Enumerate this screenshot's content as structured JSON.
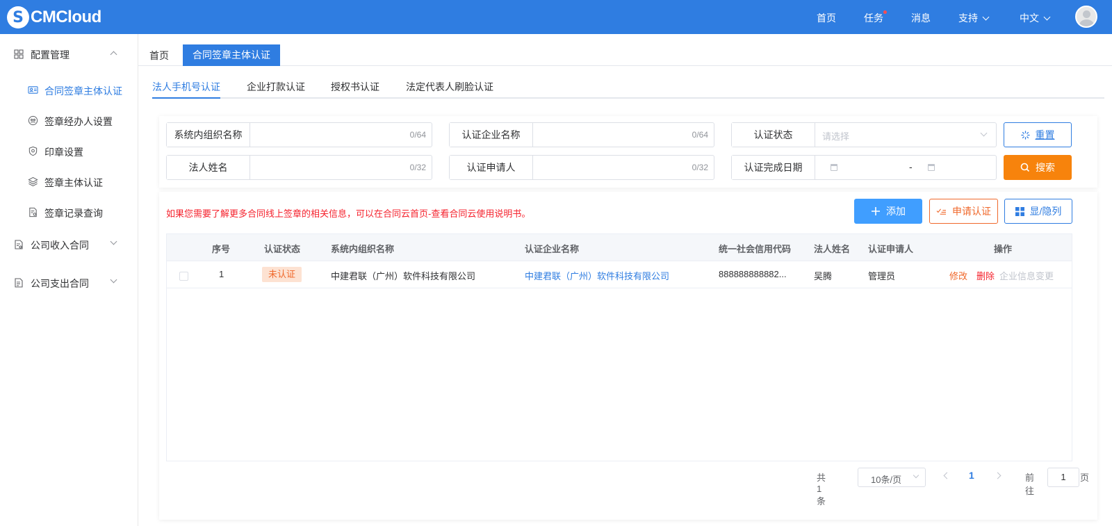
{
  "header": {
    "logo_letter": "S",
    "logo_text": "CMCloud",
    "nav": {
      "home": "首页",
      "tasks": "任务",
      "messages": "消息",
      "support": "支持",
      "language": "中文"
    },
    "colors": {
      "bar": "#2f7de1",
      "task_dot": "#ff4d4f"
    }
  },
  "sidebar": {
    "groups": [
      {
        "label": "配置管理",
        "icon": "grid-icon",
        "expanded": true
      },
      {
        "label": "公司收入合同",
        "icon": "doc-income-icon",
        "expanded": false
      },
      {
        "label": "公司支出合同",
        "icon": "doc-expense-icon",
        "expanded": false
      }
    ],
    "items": [
      {
        "label": "合同签章主体认证",
        "icon": "id-card-icon",
        "active": true
      },
      {
        "label": "签章经办人设置",
        "icon": "handler-icon",
        "active": false
      },
      {
        "label": "印章设置",
        "icon": "shield-icon",
        "active": false
      },
      {
        "label": "签章主体认证",
        "icon": "layers-icon",
        "active": false
      },
      {
        "label": "签章记录查询",
        "icon": "record-icon",
        "active": false
      }
    ]
  },
  "page_tabs": {
    "home": "首页",
    "active": "合同签章主体认证"
  },
  "sub_tabs": [
    "法人手机号认证",
    "企业打款认证",
    "授权书认证",
    "法定代表人刷脸认证"
  ],
  "filters": {
    "org_name": {
      "label": "系统内组织名称",
      "count": "0/64"
    },
    "company_name": {
      "label": "认证企业名称",
      "count": "0/64"
    },
    "status": {
      "label": "认证状态",
      "placeholder": "请选择"
    },
    "legal_name": {
      "label": "法人姓名",
      "count": "0/32"
    },
    "applicant": {
      "label": "认证申请人",
      "count": "0/32"
    },
    "finish_date": {
      "label": "认证完成日期",
      "separator": "-"
    },
    "reset_label": "重置",
    "search_label": "搜索"
  },
  "toolbar": {
    "notice": "如果您需要了解更多合同线上签章的相关信息，可以在合同云首页-查看合同云使用说明书。",
    "add_label": "添加",
    "apply_label": "申请认证",
    "columns_label": "显/隐列"
  },
  "table": {
    "headers": {
      "index": "序号",
      "status": "认证状态",
      "org": "系统内组织名称",
      "company": "认证企业名称",
      "credit_code": "统一社会信用代码",
      "legal": "法人姓名",
      "applicant": "认证申请人",
      "ops": "操作"
    },
    "rows": [
      {
        "index": "1",
        "status": "未认证",
        "org": "中建君联（广州）软件科技有限公司",
        "company": "中建君联（广州）软件科技有限公司",
        "credit_code": "888888888882...",
        "legal": "吴腾",
        "applicant": "管理员",
        "op_edit": "修改",
        "op_delete": "删除",
        "op_change": "企业信息变更"
      }
    ]
  },
  "pagination": {
    "total": "共 1 条",
    "page_size": "10条/页",
    "current": "1",
    "goto_label": "前往",
    "goto_value": "1",
    "page_unit": "页"
  }
}
